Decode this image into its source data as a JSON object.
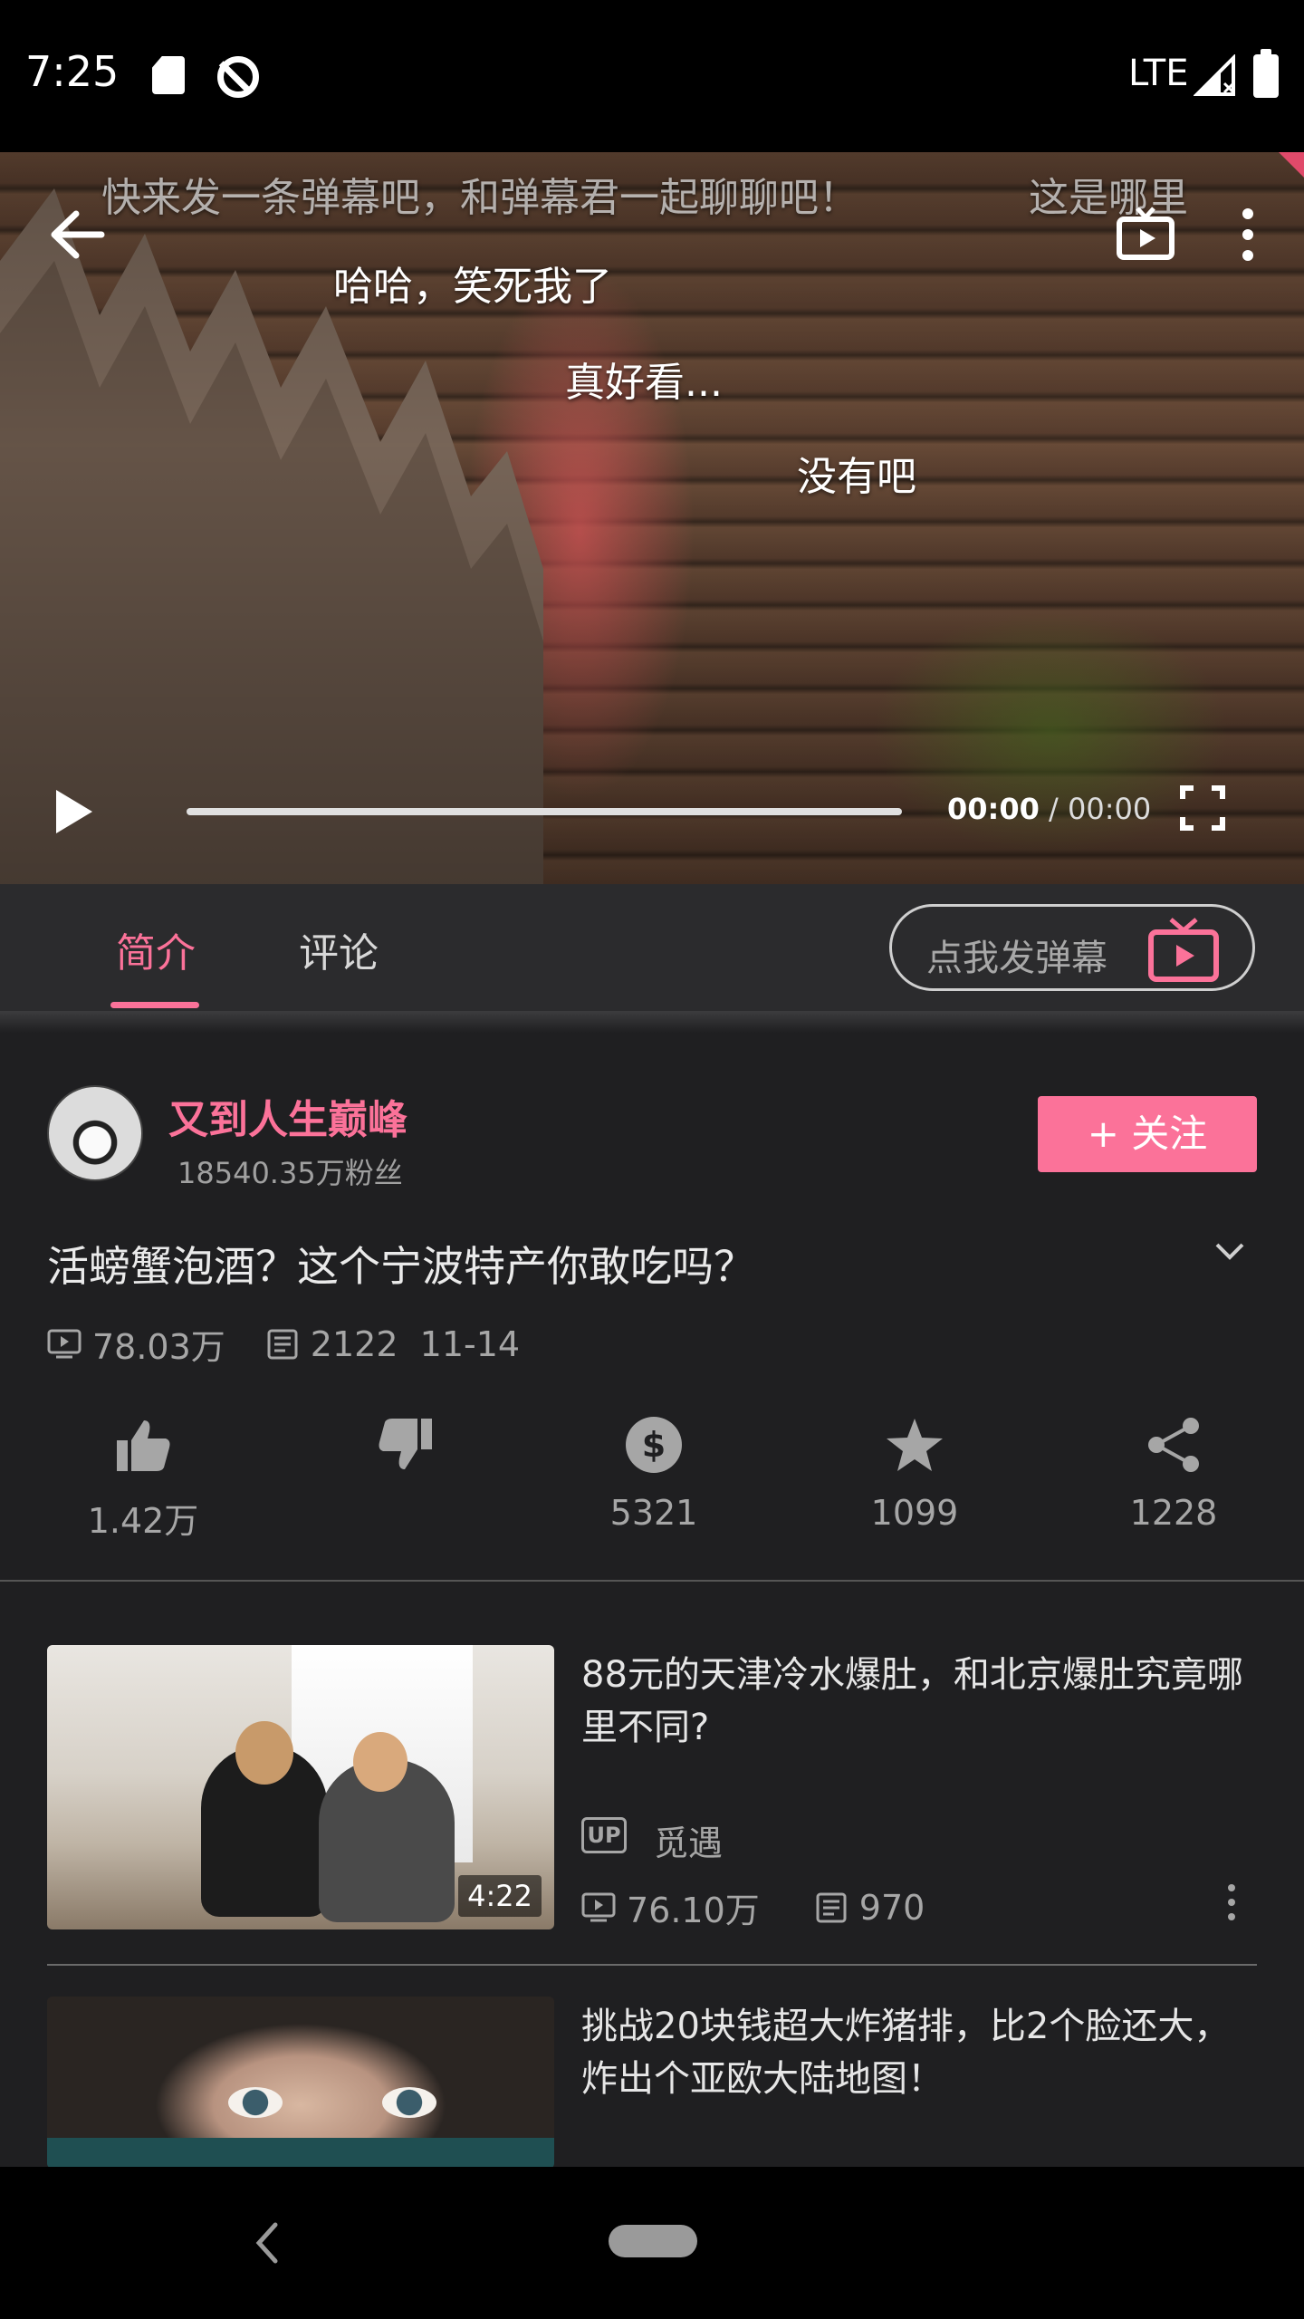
{
  "status_bar": {
    "time": "7:25",
    "network": "LTE"
  },
  "player": {
    "danmaku": [
      {
        "text": "快来发一条弹幕吧，和弹幕君一起聊聊吧！",
        "faded": true
      },
      {
        "text": "这是哪里",
        "faded": true
      },
      {
        "text": "哈哈，笑死我了",
        "faded": false
      },
      {
        "text": "真好看...",
        "faded": false
      },
      {
        "text": "没有吧",
        "faded": false
      }
    ],
    "current_time": "00:00",
    "separator": " / ",
    "total_time": "00:00",
    "progress": 0.0,
    "icons": {
      "back": "back-arrow-icon",
      "tv": "tv-play-icon",
      "more": "more-vert-icon",
      "play": "play-icon",
      "fullscreen": "fullscreen-icon"
    }
  },
  "tabs": [
    {
      "label": "简介",
      "active": true
    },
    {
      "label": "评论",
      "active": false
    }
  ],
  "danmaku_button": {
    "label": "点我发弹幕"
  },
  "uploader": {
    "name": "又到人生巅峰",
    "fans": "18540.35万粉丝",
    "follow_label": "+ 关注"
  },
  "video": {
    "title": "活螃蟹泡酒？这个宁波特产你敢吃吗？",
    "views": "78.03万",
    "danmaku_and_date": "2122  11-14"
  },
  "actions": [
    {
      "name": "like",
      "icon": "thumb-up-icon",
      "count": "1.42万"
    },
    {
      "name": "dislike",
      "icon": "thumb-down-icon",
      "count": ""
    },
    {
      "name": "coin",
      "icon": "coin-icon",
      "count": "5321"
    },
    {
      "name": "favorite",
      "icon": "star-icon",
      "count": "1099"
    },
    {
      "name": "share",
      "icon": "share-icon",
      "count": "1228"
    }
  ],
  "recommendations": [
    {
      "title": "88元的天津冷水爆肚，和北京爆肚究竟哪里不同?",
      "up_badge": "UP",
      "uploader": "觅遇",
      "views": "76.10万",
      "danmaku": "970",
      "duration": "4:22"
    },
    {
      "title": "挑战20块钱超大炸猪排，比2个脸还大，炸出个亚欧大陆地图！"
    }
  ],
  "colors": {
    "accent": "#fb7299",
    "background": "#1f1f21",
    "tabbar": "#2b2b2d"
  }
}
